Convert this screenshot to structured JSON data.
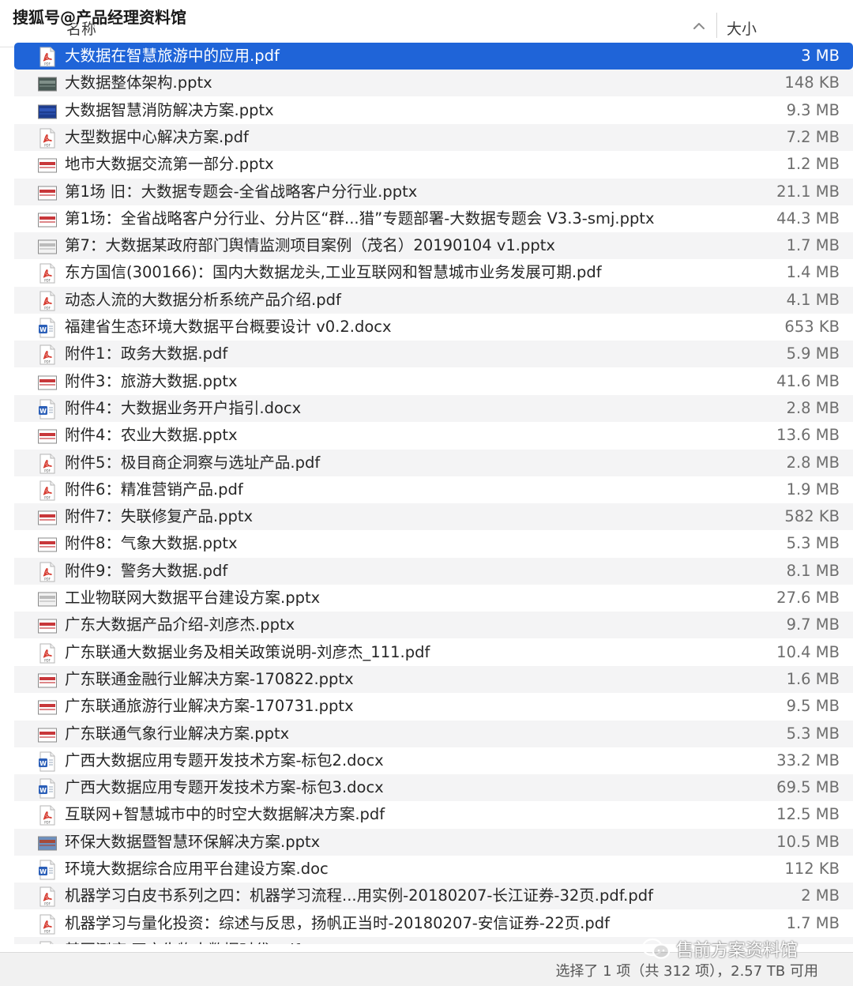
{
  "watermark_top": "搜狐号@产品经理资料馆",
  "header": {
    "name_col": "名称",
    "size_col": "大小"
  },
  "files": [
    {
      "name": "大数据在智慧旅游中的应用.pdf",
      "size": "3 MB",
      "type": "pdf"
    },
    {
      "name": "大数据整体架构.pptx",
      "size": "148 KB",
      "type": "pptx-dark"
    },
    {
      "name": "大数据智慧消防解决方案.pptx",
      "size": "9.3 MB",
      "type": "pptx-blue"
    },
    {
      "name": "大型数据中心解决方案.pdf",
      "size": "7.2 MB",
      "type": "pdf"
    },
    {
      "name": "地市大数据交流第一部分.pptx",
      "size": "1.2 MB",
      "type": "pptx"
    },
    {
      "name": "第1场 旧：大数据专题会-全省战略客户分行业.pptx",
      "size": "21.1 MB",
      "type": "pptx"
    },
    {
      "name": "第1场：全省战略客户分行业、分片区“群...猎”专题部署-大数据专题会 V3.3-smj.pptx",
      "size": "44.3 MB",
      "type": "pptx"
    },
    {
      "name": "第7：大数据某政府部门舆情监测项目案例（茂名）20190104 v1.pptx",
      "size": "1.7 MB",
      "type": "pptx-gray"
    },
    {
      "name": "东方国信(300166)：国内大数据龙头,工业互联网和智慧城市业务发展可期.pdf",
      "size": "1.4 MB",
      "type": "pdf"
    },
    {
      "name": "动态人流的大数据分析系统产品介绍.pdf",
      "size": "4.1 MB",
      "type": "pdf"
    },
    {
      "name": "福建省生态环境大数据平台概要设计 v0.2.docx",
      "size": "653 KB",
      "type": "docx"
    },
    {
      "name": "附件1：政务大数据.pdf",
      "size": "5.9 MB",
      "type": "pdf"
    },
    {
      "name": "附件3：旅游大数据.pptx",
      "size": "41.6 MB",
      "type": "pptx"
    },
    {
      "name": "附件4：大数据业务开户指引.docx",
      "size": "2.8 MB",
      "type": "docx"
    },
    {
      "name": "附件4：农业大数据.pptx",
      "size": "13.6 MB",
      "type": "pptx"
    },
    {
      "name": "附件5：极目商企洞察与选址产品.pdf",
      "size": "2.8 MB",
      "type": "pdf"
    },
    {
      "name": "附件6：精准营销产品.pdf",
      "size": "1.9 MB",
      "type": "pdf"
    },
    {
      "name": "附件7：失联修复产品.pptx",
      "size": "582 KB",
      "type": "pptx"
    },
    {
      "name": "附件8：气象大数据.pptx",
      "size": "5.3 MB",
      "type": "pptx"
    },
    {
      "name": "附件9：警务大数据.pdf",
      "size": "8.1 MB",
      "type": "pdf"
    },
    {
      "name": "工业物联网大数据平台建设方案.pptx",
      "size": "27.6 MB",
      "type": "pptx-gray"
    },
    {
      "name": "广东大数据产品介绍-刘彦杰.pptx",
      "size": "9.7 MB",
      "type": "pptx"
    },
    {
      "name": "广东联通大数据业务及相关政策说明-刘彦杰_111.pdf",
      "size": "10.4 MB",
      "type": "pdf"
    },
    {
      "name": "广东联通金融行业解决方案-170822.pptx",
      "size": "1.6 MB",
      "type": "pptx"
    },
    {
      "name": "广东联通旅游行业解决方案-170731.pptx",
      "size": "9.5 MB",
      "type": "pptx"
    },
    {
      "name": "广东联通气象行业解决方案.pptx",
      "size": "5.3 MB",
      "type": "pptx"
    },
    {
      "name": "广西大数据应用专题开发技术方案-标包2.docx",
      "size": "33.2 MB",
      "type": "docx"
    },
    {
      "name": "广西大数据应用专题开发技术方案-标包3.docx",
      "size": "69.5 MB",
      "type": "docx"
    },
    {
      "name": "互联网+智慧城市中的时空大数据解决方案.pdf",
      "size": "12.5 MB",
      "type": "pdf"
    },
    {
      "name": "环保大数据暨智慧环保解决方案.pptx",
      "size": "10.5 MB",
      "type": "pptx-photo"
    },
    {
      "name": "环境大数据综合应用平台建设方案.doc",
      "size": "112 KB",
      "type": "doc"
    },
    {
      "name": "机器学习白皮书系列之四：机器学习流程...用实例-20180207-长江证券-32页.pdf.pdf",
      "size": "2 MB",
      "type": "pdf"
    },
    {
      "name": "机器学习与量化投资：综述与反思，扬帆正当时-20180207-安信证券-22页.pdf",
      "size": "1.7 MB",
      "type": "pdf"
    },
    {
      "name": "基因测序 开启生物大数据时代.pdf",
      "size": "",
      "type": "pdf"
    }
  ],
  "status": "选择了 1 项（共 312 项），2.57 TB 可用",
  "watermark_bottom": "售前方案资料馆",
  "colors": {
    "selection": "#1f64d8",
    "pdf": "#d63a2f",
    "word": "#2b5fb8",
    "ppt": "#c8373a"
  }
}
